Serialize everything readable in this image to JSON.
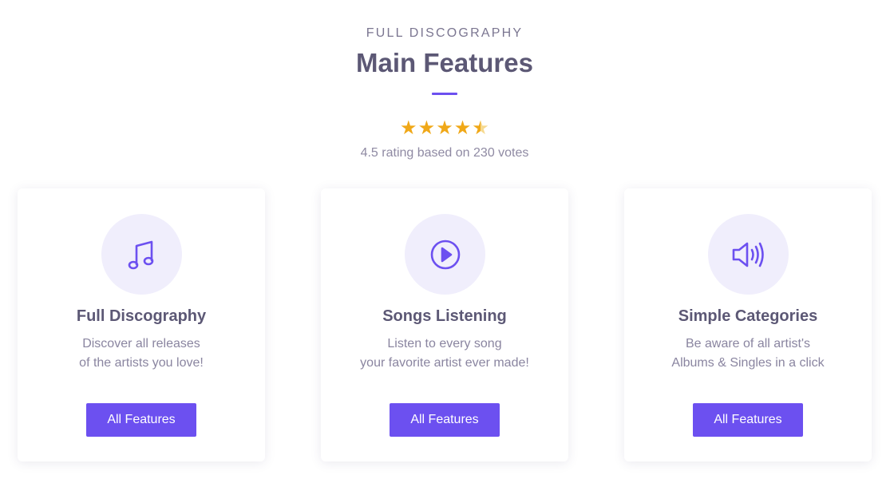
{
  "header": {
    "eyebrow": "FULL DISCOGRAPHY",
    "title": "Main Features",
    "accent_color": "#6c50f0"
  },
  "rating": {
    "value": 4.5,
    "max": 5,
    "text": "4.5 rating based on 230 votes",
    "star_color": "#f0a818"
  },
  "cards": [
    {
      "icon": "music-note-icon",
      "title": "Full Discography",
      "desc_line1": "Discover all releases",
      "desc_line2": "of the artists you love!",
      "button_label": "All Features"
    },
    {
      "icon": "play-circle-icon",
      "title": "Songs Listening",
      "desc_line1": "Listen to every song",
      "desc_line2": "your favorite artist ever made!",
      "button_label": "All Features"
    },
    {
      "icon": "volume-icon",
      "title": "Simple Categories",
      "desc_line1": "Be aware of all artist's",
      "desc_line2": "Albums & Singles in a click",
      "button_label": "All Features"
    }
  ]
}
